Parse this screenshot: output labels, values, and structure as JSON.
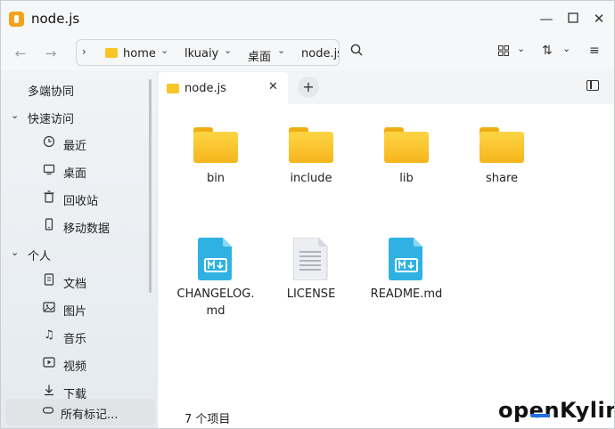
{
  "window": {
    "title": "node.js",
    "controls": [
      "minimize",
      "maximize",
      "close"
    ]
  },
  "toolbar": {
    "breadcrumbs": [
      "home",
      "lkuaiy",
      "桌面",
      "node.js"
    ]
  },
  "sidebar": {
    "items": [
      {
        "label": "多端协同",
        "icon": ""
      },
      {
        "label": "快速访问",
        "icon": "chevron-down"
      },
      {
        "label": "最近",
        "icon": "clock-icon"
      },
      {
        "label": "桌面",
        "icon": "desktop-icon"
      },
      {
        "label": "回收站",
        "icon": "trash-icon"
      },
      {
        "label": "移动数据",
        "icon": "mobile-data-icon"
      },
      {
        "label": "个人",
        "icon": "chevron-down"
      },
      {
        "label": "文档",
        "icon": "document-icon"
      },
      {
        "label": "图片",
        "icon": "image-icon"
      },
      {
        "label": "音乐",
        "icon": "music-icon"
      },
      {
        "label": "视频",
        "icon": "video-icon"
      },
      {
        "label": "下载",
        "icon": "download-icon"
      },
      {
        "label": "所有标记...",
        "icon": "tag-icon"
      }
    ]
  },
  "tabs": [
    {
      "label": "node.js"
    }
  ],
  "files": [
    {
      "name": "bin",
      "type": "folder"
    },
    {
      "name": "include",
      "type": "folder"
    },
    {
      "name": "lib",
      "type": "folder"
    },
    {
      "name": "share",
      "type": "folder"
    },
    {
      "name": "CHANGELOG.md",
      "line1": "CHANGELOG.",
      "line2": "md",
      "type": "markdown"
    },
    {
      "name": "LICENSE",
      "type": "text"
    },
    {
      "name": "README.md",
      "type": "markdown"
    }
  ],
  "status": "7 个项目",
  "watermark": "openKylin",
  "colors": {
    "folder": "#f8c527",
    "markdown": "#2fb2e3",
    "accent": "#1f6fe0"
  }
}
